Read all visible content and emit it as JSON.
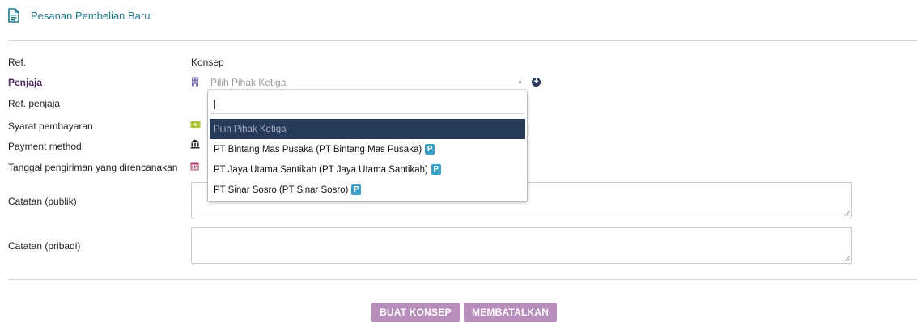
{
  "header": {
    "title": "Pesanan Pembelian Baru"
  },
  "form": {
    "ref_label": "Ref.",
    "ref_value": "Konsep",
    "vendor_label": "Penjaja",
    "vendor_placeholder": "Pilih Pihak Ketiga",
    "vendor_ref_label": "Ref. penjaja",
    "payment_terms_label": "Syarat pembayaran",
    "payment_method_label": "Payment method",
    "delivery_date_label": "Tanggal pengiriman yang direncanakan",
    "public_note_label": "Catatan (publik)",
    "private_note_label": "Catatan (pribadi)"
  },
  "dropdown": {
    "options": [
      {
        "label": "Pilih Pihak Ketiga",
        "badge": ""
      },
      {
        "label": "PT Bintang Mas Pusaka (PT Bintang Mas Pusaka)",
        "badge": "P"
      },
      {
        "label": "PT Jaya Utama Santikah (PT Jaya Utama Santikah)",
        "badge": "P"
      },
      {
        "label": "PT Sinar Sosro (PT Sinar Sosro)",
        "badge": "P"
      }
    ],
    "selected_index": 0
  },
  "buttons": {
    "create_draft": "BUAT KONSEP",
    "cancel": "MEMBATALKAN"
  },
  "colors": {
    "title": "#1f7a8c",
    "required_label": "#4a2a5c",
    "selected_option_bg": "#263a5a",
    "badge": "#3a9fc5",
    "button": "#b78dbb"
  },
  "icons": {
    "title": "document-icon",
    "vendor": "building-icon",
    "add": "plus-circle-icon",
    "payment_terms": "money-icon",
    "payment_method": "bank-icon",
    "delivery_date": "calendar-icon"
  }
}
